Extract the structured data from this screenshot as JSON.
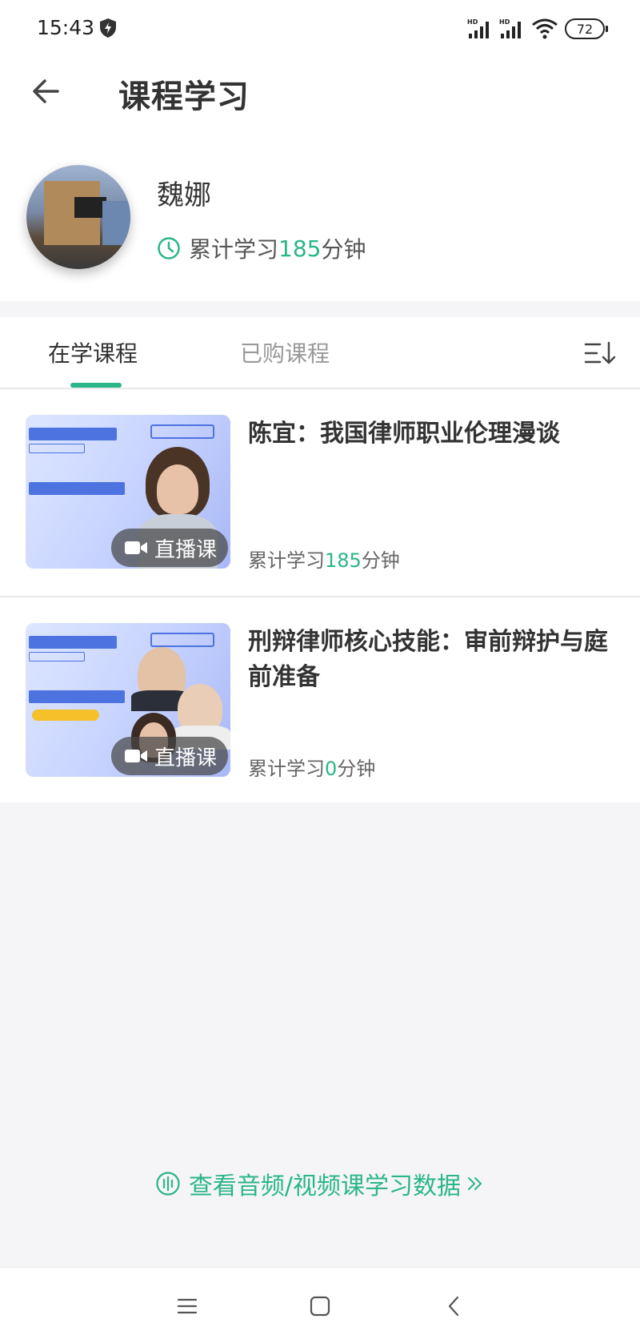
{
  "status_bar": {
    "time": "15:43",
    "battery": "72",
    "icons": [
      "shield-icon",
      "signal-hd-icon",
      "signal-hd-icon",
      "wifi-icon",
      "battery-icon"
    ]
  },
  "header": {
    "title": "课程学习",
    "back_icon": "arrow-left-icon"
  },
  "profile": {
    "name": "魏娜",
    "study_prefix": "累计学习",
    "study_minutes": "185",
    "study_suffix": "分钟"
  },
  "tabs": {
    "items": [
      {
        "label": "在学课程",
        "active": true
      },
      {
        "label": "已购课程",
        "active": false
      }
    ],
    "sort_icon": "sort-descending-icon"
  },
  "courses": [
    {
      "title": "陈宜：我国律师职业伦理漫谈",
      "badge": "直播课",
      "stat_prefix": "累计学习",
      "stat_minutes": "185",
      "stat_suffix": "分钟"
    },
    {
      "title": "刑辩律师核心技能：审前辩护与庭前准备",
      "badge": "直播课",
      "stat_prefix": "累计学习",
      "stat_minutes": "0",
      "stat_suffix": "分钟"
    }
  ],
  "footer": {
    "link": "查看音频/视频课学习数据"
  },
  "colors": {
    "accent": "#2bb58a",
    "background": "#f5f5f7"
  }
}
